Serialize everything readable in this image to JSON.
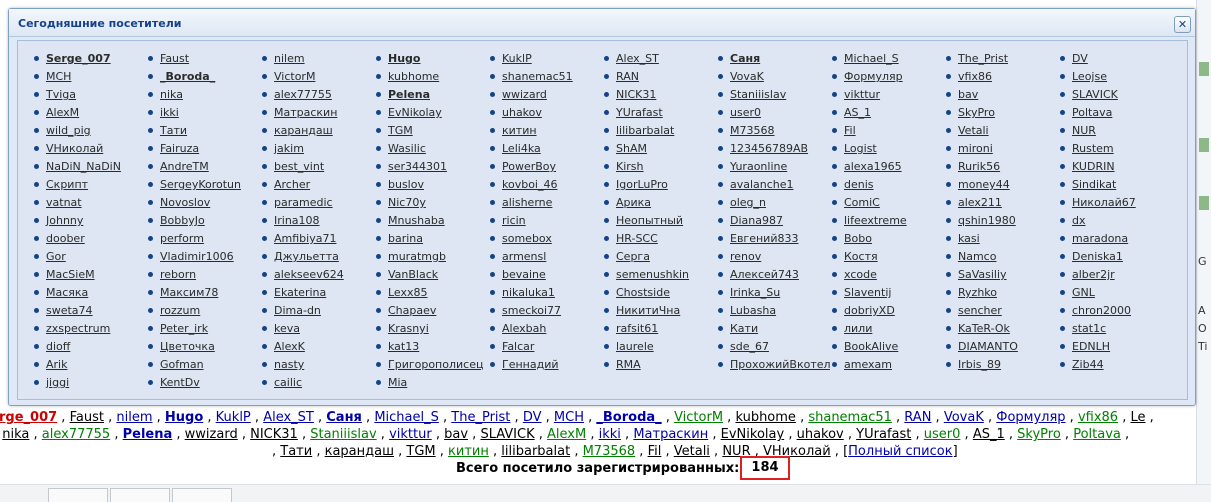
{
  "dialog": {
    "title": "Сегодняшние посетители",
    "close_label": "✕",
    "users": [
      [
        {
          "n": "Serge_007",
          "b": true
        },
        {
          "n": "MCH"
        },
        {
          "n": "Tviga"
        },
        {
          "n": "AlexM"
        },
        {
          "n": "wild_pig"
        },
        {
          "n": "VНиколай"
        },
        {
          "n": "NaDiN_NaDiN"
        },
        {
          "n": "Скрипт"
        },
        {
          "n": "vatnat"
        },
        {
          "n": "Johnny"
        },
        {
          "n": "doober"
        },
        {
          "n": "Gor"
        },
        {
          "n": "MacSieM"
        },
        {
          "n": "Масяка"
        },
        {
          "n": "sweta74"
        },
        {
          "n": "zxspectrum"
        },
        {
          "n": "dioff"
        },
        {
          "n": "Arik"
        },
        {
          "n": "jiggi"
        }
      ],
      [
        {
          "n": "Faust"
        },
        {
          "n": "_Boroda_",
          "b": true
        },
        {
          "n": "nika"
        },
        {
          "n": "ikki"
        },
        {
          "n": "Тати"
        },
        {
          "n": "Fairuza"
        },
        {
          "n": "AndreTM"
        },
        {
          "n": "SergeyKorotun"
        },
        {
          "n": "Novoslov"
        },
        {
          "n": "BobbyJo"
        },
        {
          "n": "perform"
        },
        {
          "n": "Vladimir1006"
        },
        {
          "n": "reborn"
        },
        {
          "n": "Максим78"
        },
        {
          "n": "rozzum"
        },
        {
          "n": "Peter_irk"
        },
        {
          "n": "Цветочка"
        },
        {
          "n": "Gofman"
        },
        {
          "n": "KentDv"
        }
      ],
      [
        {
          "n": "nilem"
        },
        {
          "n": "VictorM"
        },
        {
          "n": "alex77755"
        },
        {
          "n": "Матраскин"
        },
        {
          "n": "карандаш"
        },
        {
          "n": "jakim"
        },
        {
          "n": "best_vint"
        },
        {
          "n": "Archer"
        },
        {
          "n": "paramedic"
        },
        {
          "n": "Irina108"
        },
        {
          "n": "Amfibiya71"
        },
        {
          "n": "Джульетта"
        },
        {
          "n": "alekseev624"
        },
        {
          "n": "Ekaterina"
        },
        {
          "n": "Dima-dn"
        },
        {
          "n": "keva"
        },
        {
          "n": "AlexK"
        },
        {
          "n": "nasty"
        },
        {
          "n": "cailic"
        }
      ],
      [
        {
          "n": "Hugo",
          "b": true
        },
        {
          "n": "kubhome"
        },
        {
          "n": "Pelena",
          "b": true
        },
        {
          "n": "EvNikolay"
        },
        {
          "n": "TGM"
        },
        {
          "n": "Wasilic"
        },
        {
          "n": "ser344301"
        },
        {
          "n": "buslov"
        },
        {
          "n": "Nic70y"
        },
        {
          "n": "Mnushaba"
        },
        {
          "n": "barina"
        },
        {
          "n": "muratmgb"
        },
        {
          "n": "VanBlack"
        },
        {
          "n": "Lexx85"
        },
        {
          "n": "Chapaev"
        },
        {
          "n": "Krasnyi"
        },
        {
          "n": "kat13"
        },
        {
          "n": "Григорополисец"
        },
        {
          "n": "Mia"
        }
      ],
      [
        {
          "n": "KuklP"
        },
        {
          "n": "shanemac51"
        },
        {
          "n": "wwizard"
        },
        {
          "n": "uhakov"
        },
        {
          "n": "китин"
        },
        {
          "n": "Leli4ka"
        },
        {
          "n": "PowerBoy"
        },
        {
          "n": "kovboi_46"
        },
        {
          "n": "alisherne"
        },
        {
          "n": "ricin"
        },
        {
          "n": "somebox"
        },
        {
          "n": "armensl"
        },
        {
          "n": "bevaine"
        },
        {
          "n": "nikaluka1"
        },
        {
          "n": "smeckoi77"
        },
        {
          "n": "Alexbah"
        },
        {
          "n": "Falcar"
        },
        {
          "n": "Геннадий"
        }
      ],
      [
        {
          "n": "Alex_ST"
        },
        {
          "n": "RAN"
        },
        {
          "n": "NICK31"
        },
        {
          "n": "YUrafast"
        },
        {
          "n": "lilibarbalat"
        },
        {
          "n": "ShAM"
        },
        {
          "n": "Kirsh"
        },
        {
          "n": "IgorLuPro"
        },
        {
          "n": "Арика"
        },
        {
          "n": "Неопытный"
        },
        {
          "n": "HR-SCC"
        },
        {
          "n": "Серга"
        },
        {
          "n": "semenushkin"
        },
        {
          "n": "Chostside"
        },
        {
          "n": "НикитиЧна"
        },
        {
          "n": "rafsit61"
        },
        {
          "n": "laurele"
        },
        {
          "n": "RMA"
        }
      ],
      [
        {
          "n": "Саня",
          "b": true
        },
        {
          "n": "VovaK"
        },
        {
          "n": "Staniiislav"
        },
        {
          "n": "user0"
        },
        {
          "n": "M73568"
        },
        {
          "n": "123456789AB"
        },
        {
          "n": "Yuraonline"
        },
        {
          "n": "avalanche1"
        },
        {
          "n": "oleg_n"
        },
        {
          "n": "Diana987"
        },
        {
          "n": "Евгений833"
        },
        {
          "n": "renov"
        },
        {
          "n": "Алексей743"
        },
        {
          "n": "Irinka_Su"
        },
        {
          "n": "Lubasha"
        },
        {
          "n": "Кати"
        },
        {
          "n": "sde_67"
        },
        {
          "n": "ПрохожийВкотелке"
        }
      ],
      [
        {
          "n": "Michael_S"
        },
        {
          "n": "Формуляр"
        },
        {
          "n": "vikttur"
        },
        {
          "n": "AS_1"
        },
        {
          "n": "Fil"
        },
        {
          "n": "Logist"
        },
        {
          "n": "alexa1965"
        },
        {
          "n": "denis"
        },
        {
          "n": "ComiC"
        },
        {
          "n": "lifeextreme"
        },
        {
          "n": "Bobo"
        },
        {
          "n": "Костя"
        },
        {
          "n": "xcode"
        },
        {
          "n": "Slaventij"
        },
        {
          "n": "dobriyXD"
        },
        {
          "n": "лили"
        },
        {
          "n": "BookAlive"
        },
        {
          "n": "amexam"
        }
      ],
      [
        {
          "n": "The_Prist"
        },
        {
          "n": "vfix86"
        },
        {
          "n": "bav"
        },
        {
          "n": "SkyPro"
        },
        {
          "n": "Vetali"
        },
        {
          "n": "mironi"
        },
        {
          "n": "Rurik56"
        },
        {
          "n": "money44"
        },
        {
          "n": "alex211"
        },
        {
          "n": "qshin1980"
        },
        {
          "n": "kasi"
        },
        {
          "n": "Namco"
        },
        {
          "n": "SaVasiliy"
        },
        {
          "n": "Ryzhko"
        },
        {
          "n": "sencher"
        },
        {
          "n": "KaTeR-Ok"
        },
        {
          "n": "DIAMANTO"
        },
        {
          "n": "Irbis_89"
        }
      ],
      [
        {
          "n": "DV"
        },
        {
          "n": "Leojse"
        },
        {
          "n": "SLAVICK"
        },
        {
          "n": "Poltava"
        },
        {
          "n": "NUR"
        },
        {
          "n": "Rustem"
        },
        {
          "n": "KUDRIN"
        },
        {
          "n": "Sindikat"
        },
        {
          "n": "Николай67"
        },
        {
          "n": "dx"
        },
        {
          "n": "maradona"
        },
        {
          "n": "Deniska1"
        },
        {
          "n": "alber2jr"
        },
        {
          "n": "GNL"
        },
        {
          "n": "chron2000"
        },
        {
          "n": "stat1c"
        },
        {
          "n": "EDNLH"
        },
        {
          "n": "Zib44"
        }
      ]
    ]
  },
  "footer": {
    "line1": [
      {
        "t": "rge_007",
        "c": "red",
        "b": true
      },
      {
        "t": "Faust",
        "c": "black"
      },
      {
        "t": "nilem",
        "c": "blue"
      },
      {
        "t": "Hugo",
        "c": "blue",
        "b": true
      },
      {
        "t": "KuklP",
        "c": "blue"
      },
      {
        "t": "Alex_ST",
        "c": "blue"
      },
      {
        "t": "Саня",
        "c": "blue",
        "b": true
      },
      {
        "t": "Michael_S",
        "c": "blue"
      },
      {
        "t": "The_Prist",
        "c": "blue"
      },
      {
        "t": "DV",
        "c": "blue"
      },
      {
        "t": "MCH",
        "c": "blue"
      },
      {
        "t": "_Boroda_",
        "c": "blue",
        "b": true
      },
      {
        "t": "VictorM",
        "c": "green"
      },
      {
        "t": "kubhome",
        "c": "black"
      },
      {
        "t": "shanemac51",
        "c": "green"
      },
      {
        "t": "RAN",
        "c": "blue"
      },
      {
        "t": "VovaK",
        "c": "blue"
      },
      {
        "t": "Формуляр",
        "c": "blue"
      },
      {
        "t": "vfix86",
        "c": "green"
      },
      {
        "t": "Le",
        "c": "black"
      }
    ],
    "line2": [
      {
        "t": "nika",
        "c": "black"
      },
      {
        "t": "alex77755",
        "c": "green"
      },
      {
        "t": "Pelena",
        "c": "blue",
        "b": true
      },
      {
        "t": "wwizard",
        "c": "black"
      },
      {
        "t": "NICK31",
        "c": "black"
      },
      {
        "t": "Staniiislav",
        "c": "green"
      },
      {
        "t": "vikttur",
        "c": "blue"
      },
      {
        "t": "bav",
        "c": "black"
      },
      {
        "t": "SLAVICK",
        "c": "black"
      },
      {
        "t": "AlexM",
        "c": "green"
      },
      {
        "t": "ikki",
        "c": "blue"
      },
      {
        "t": "Матраскин",
        "c": "blue"
      },
      {
        "t": "EvNikolay",
        "c": "black"
      },
      {
        "t": "uhakov",
        "c": "black"
      },
      {
        "t": "YUrafast",
        "c": "black"
      },
      {
        "t": "user0",
        "c": "green"
      },
      {
        "t": "AS_1",
        "c": "black"
      },
      {
        "t": "SkyPro",
        "c": "green"
      },
      {
        "t": "Poltava",
        "c": "green"
      }
    ],
    "line3": [
      {
        "t": "Тати",
        "c": "black"
      },
      {
        "t": "карандаш",
        "c": "black"
      },
      {
        "t": "TGM",
        "c": "black"
      },
      {
        "t": "китин",
        "c": "green"
      },
      {
        "t": "lilibarbalat",
        "c": "black"
      },
      {
        "t": "M73568",
        "c": "green"
      },
      {
        "t": "Fil",
        "c": "black"
      },
      {
        "t": "Vetali",
        "c": "black"
      },
      {
        "t": "NUR",
        "c": "black"
      },
      {
        "t": "VНиколай",
        "c": "black"
      }
    ],
    "full_list_label": "Полный список",
    "total_label": "Всего посетило зарегистрированных:",
    "total_count": "184"
  },
  "background": {
    "right_letters": [
      "G",
      "A",
      "O",
      "Ti"
    ]
  },
  "colors": {
    "header_text": "#15428b",
    "link_blue": "#0000aa",
    "link_green": "#008000",
    "link_red": "#cc0000",
    "highlight_box": "#e02020"
  }
}
